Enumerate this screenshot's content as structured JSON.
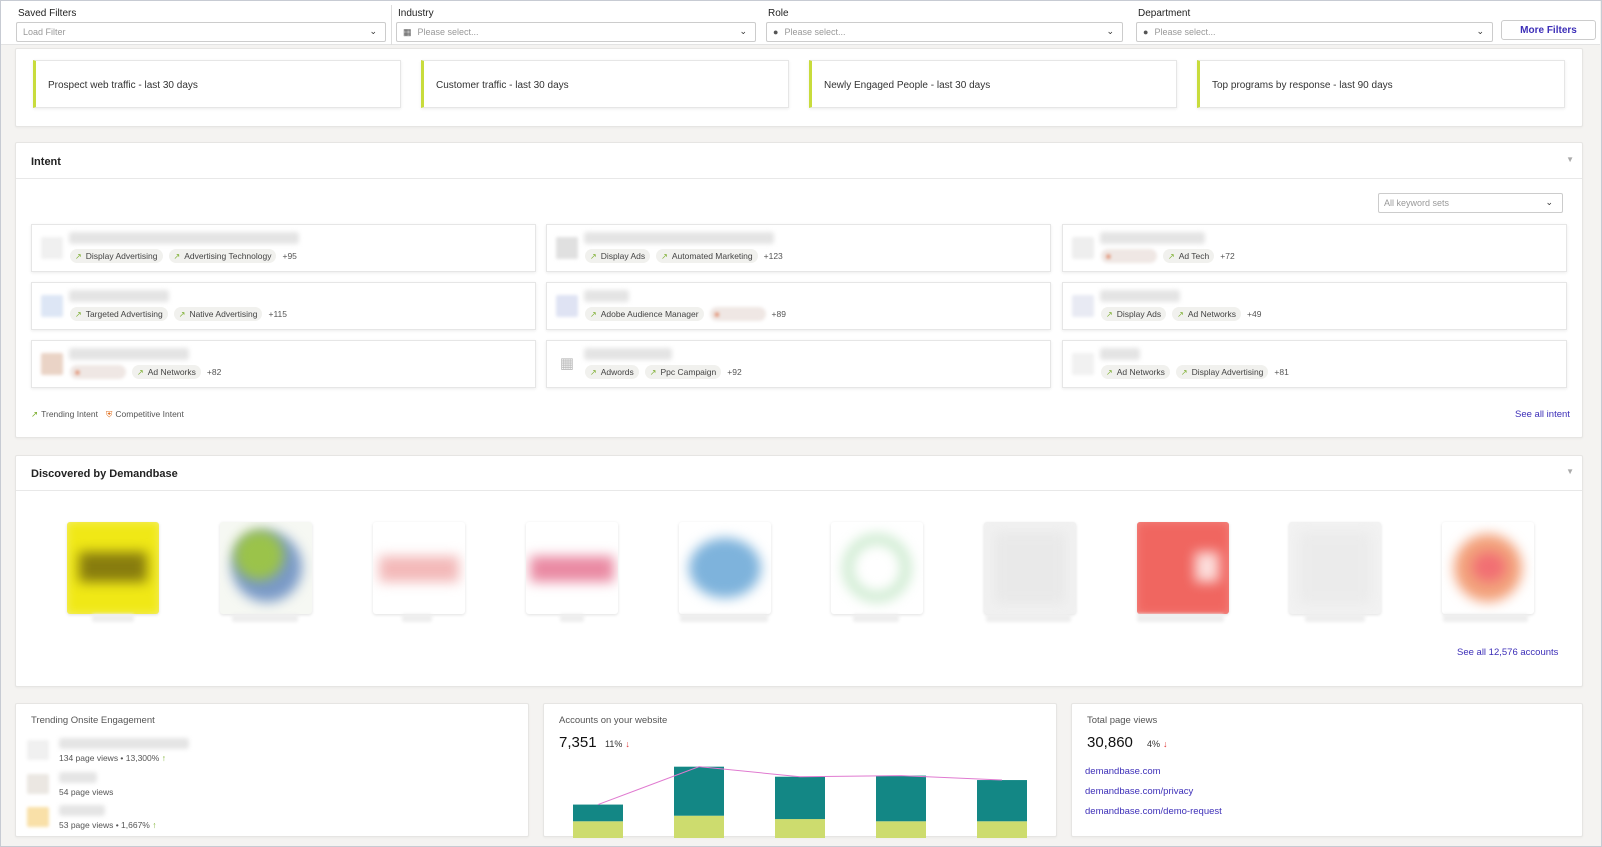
{
  "filters": {
    "saved": {
      "label": "Saved Filters",
      "placeholder": "Load Filter"
    },
    "industry": {
      "label": "Industry",
      "placeholder": "Please select..."
    },
    "role": {
      "label": "Role",
      "placeholder": "Please select..."
    },
    "department": {
      "label": "Department",
      "placeholder": "Please select..."
    },
    "more_label": "More Filters"
  },
  "report_cards": [
    "Prospect web traffic - last 30 days",
    "Customer traffic - last 30 days",
    "Newly Engaged People - last 30 days",
    "Top programs by response - last 90 days"
  ],
  "intent": {
    "title": "Intent",
    "keyword_select": "All keyword sets",
    "cards": [
      {
        "tags": [
          "Display Advertising",
          "Advertising Technology"
        ],
        "more": "+95"
      },
      {
        "tags": [
          "Display Ads",
          "Automated Marketing"
        ],
        "more": "+123"
      },
      {
        "tags": [
          "Ad Tech"
        ],
        "more": "+72"
      },
      {
        "tags": [
          "Targeted Advertising",
          "Native Advertising"
        ],
        "more": "+115"
      },
      {
        "tags": [
          "Adobe Audience Manager"
        ],
        "more": "+89"
      },
      {
        "tags": [
          "Display Ads",
          "Ad Networks"
        ],
        "more": "+49"
      },
      {
        "tags": [
          "Ad Networks"
        ],
        "more": "+82"
      },
      {
        "tags": [
          "Adwords",
          "Ppc Campaign"
        ],
        "more": "+92"
      },
      {
        "tags": [
          "Ad Networks",
          "Display Advertising"
        ],
        "more": "+81"
      }
    ],
    "legend_trending": "Trending Intent",
    "legend_competitive": "Competitive Intent",
    "see_all": "See all intent"
  },
  "discovered": {
    "title": "Discovered by Demandbase",
    "see_all": "See all 12,576 accounts"
  },
  "trending": {
    "title": "Trending Onsite Engagement",
    "items": [
      {
        "views": "134 page views • 13,300%",
        "up": "↑"
      },
      {
        "views": "54 page views",
        "up": ""
      },
      {
        "views": "53 page views • 1,667%",
        "up": "↑"
      }
    ]
  },
  "accounts": {
    "title": "Accounts on your website",
    "value": "7,351",
    "change": "11%",
    "arrow": "↓"
  },
  "pageviews": {
    "title": "Total page views",
    "value": "30,860",
    "change": "4%",
    "arrow": "↓",
    "links": [
      "demandbase.com",
      "demandbase.com/privacy",
      "demandbase.com/demo-request"
    ]
  },
  "chart_data": {
    "type": "bar",
    "stacked": true,
    "categories": [
      "",
      "",
      "",
      "",
      ""
    ],
    "series": [
      {
        "values": [
          15,
          20,
          17,
          15,
          15
        ],
        "color": "#cddc6e"
      },
      {
        "values": [
          15,
          44,
          38,
          41,
          37
        ],
        "color": "#138785"
      },
      {
        "type": "line",
        "values": [
          30,
          64,
          55,
          56,
          52
        ],
        "color": "#e07ad0"
      }
    ],
    "ylim": [
      0,
      70
    ],
    "grid": false,
    "legend": "none"
  }
}
